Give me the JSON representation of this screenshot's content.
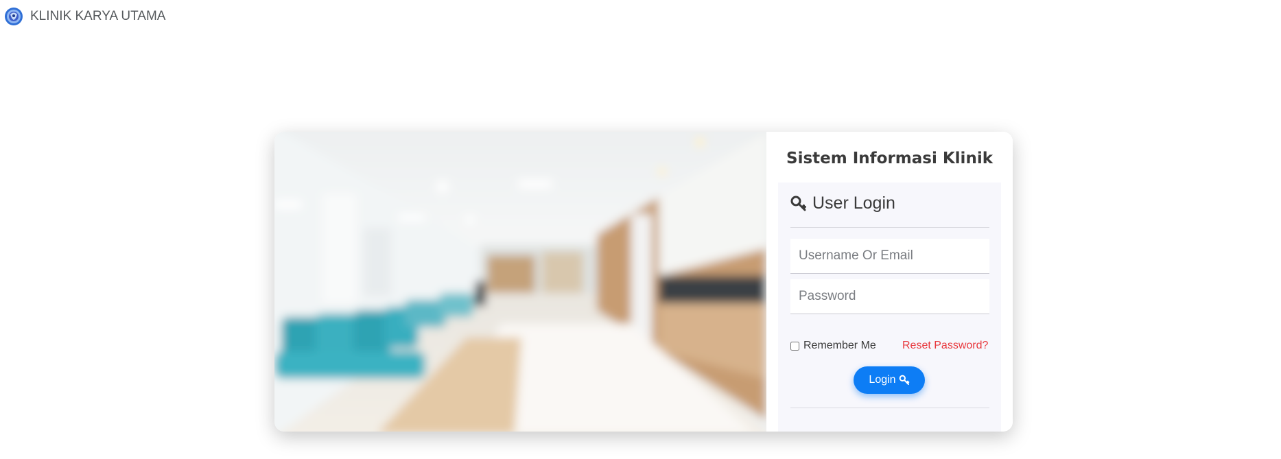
{
  "brand": {
    "name": "KLINIK KARYA UTAMA",
    "logo_icon": "clinic-logo-icon"
  },
  "login": {
    "system_title": "Sistem Informasi Klinik",
    "heading": "User Login",
    "heading_icon": "key-icon",
    "username_placeholder": "Username Or Email",
    "username_value": "",
    "password_placeholder": "Password",
    "password_value": "",
    "remember_label": "Remember Me",
    "remember_checked": false,
    "reset_link": "Reset Password?",
    "submit_label": "Login",
    "submit_icon": "key-icon"
  },
  "hero_image": {
    "description_icon": "clinic-hallway-photo"
  },
  "colors": {
    "primary": "#0d7df5",
    "danger": "#e8383d",
    "panel_bg": "#f7f7fc",
    "text": "#3a3a3a"
  }
}
